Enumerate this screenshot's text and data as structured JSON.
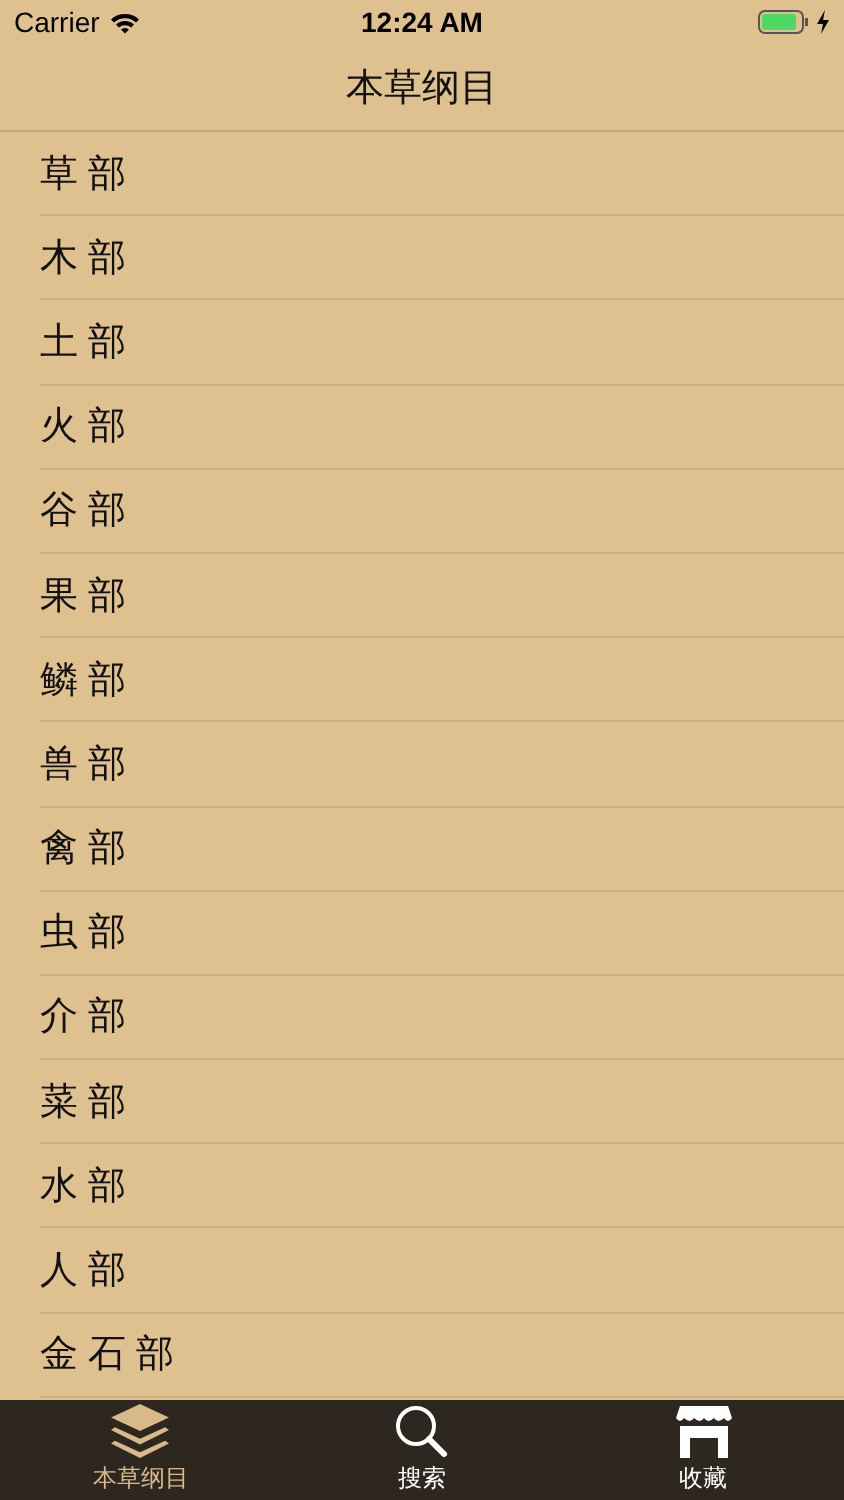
{
  "status_bar": {
    "carrier": "Carrier",
    "time": "12:24 AM",
    "battery_charging": true
  },
  "nav_bar": {
    "title": "本草纲目"
  },
  "list": {
    "items": [
      {
        "label": "草部"
      },
      {
        "label": "木部"
      },
      {
        "label": "土部"
      },
      {
        "label": "火部"
      },
      {
        "label": "谷部"
      },
      {
        "label": "果部"
      },
      {
        "label": "鳞部"
      },
      {
        "label": "兽部"
      },
      {
        "label": "禽部"
      },
      {
        "label": "虫部"
      },
      {
        "label": "介部"
      },
      {
        "label": "菜部"
      },
      {
        "label": "水部"
      },
      {
        "label": "人部"
      },
      {
        "label": "金石部"
      }
    ]
  },
  "tab_bar": {
    "tabs": [
      {
        "label": "本草纲目",
        "kind": "layers",
        "selected": true
      },
      {
        "label": "搜索",
        "kind": "search",
        "selected": false
      },
      {
        "label": "收藏",
        "kind": "store",
        "selected": false
      }
    ]
  }
}
